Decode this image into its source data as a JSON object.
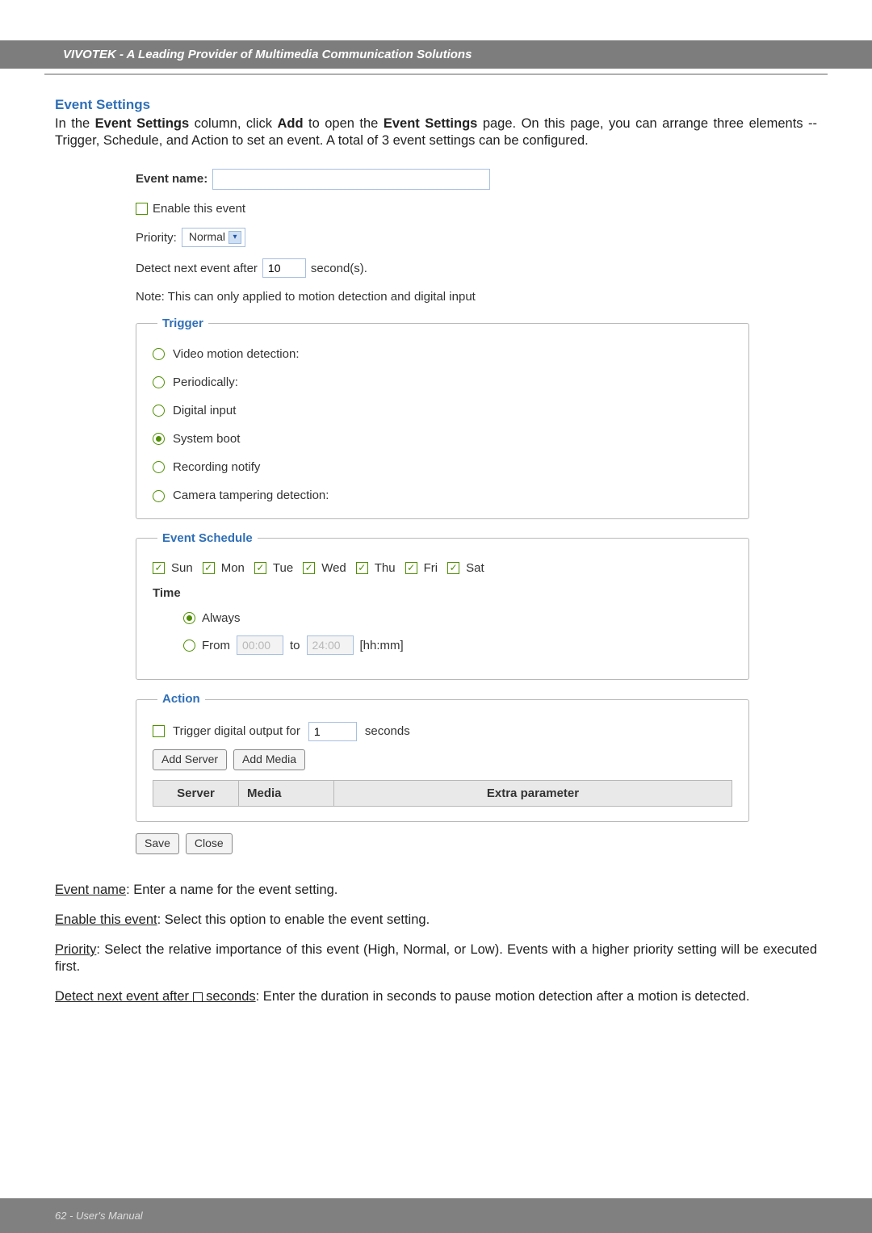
{
  "header": {
    "brand_text": "VIVOTEK - A Leading Provider of Multimedia Communication Solutions"
  },
  "section": {
    "title": "Event Settings",
    "intro_html": "In the <b>Event Settings</b> column, click <b>Add</b> to open the <b>Event Settings</b> page. On this page, you can arrange three elements -- Trigger, Schedule, and Action to set an event. A total of 3 event settings can be configured."
  },
  "form": {
    "event_name_label": "Event name:",
    "event_name_value": "",
    "enable_label": "Enable this event",
    "enable_checked": false,
    "priority_label": "Priority:",
    "priority_value": "Normal",
    "detect_label_prefix": "Detect next event after",
    "detect_value": "10",
    "detect_label_suffix": "second(s).",
    "note_text": "Note: This can only applied to motion detection and digital input"
  },
  "trigger": {
    "legend": "Trigger",
    "options": {
      "video_motion": "Video motion detection:",
      "periodically": "Periodically:",
      "digital_input": "Digital input",
      "system_boot": "System boot",
      "recording_notify": "Recording notify",
      "tampering": "Camera tampering detection:"
    },
    "selected": "system_boot"
  },
  "schedule": {
    "legend": "Event Schedule",
    "days": [
      "Sun",
      "Mon",
      "Tue",
      "Wed",
      "Thu",
      "Fri",
      "Sat"
    ],
    "days_checked": [
      true,
      true,
      true,
      true,
      true,
      true,
      true
    ],
    "time_label": "Time",
    "always_label": "Always",
    "from_label": "From",
    "from_value": "00:00",
    "to_label": "to",
    "to_value": "24:00",
    "hhmm_label": "[hh:mm]",
    "selected": "always"
  },
  "action": {
    "legend": "Action",
    "trigger_do_label": "Trigger digital output for",
    "trigger_do_value": "1",
    "trigger_do_suffix": "seconds",
    "trigger_do_checked": false,
    "add_server_btn": "Add Server",
    "add_media_btn": "Add Media",
    "table_headers": {
      "server": "Server",
      "media": "Media",
      "extra": "Extra parameter"
    }
  },
  "buttons": {
    "save": "Save",
    "close": "Close"
  },
  "descriptions": {
    "event_name": "Event name",
    "event_name_text": ": Enter a name for the event setting.",
    "enable": "Enable this event",
    "enable_text": ": Select this option to enable the event setting.",
    "priority": "Priority",
    "priority_text": ": Select the relative importance of this event (High, Normal, or Low). Events with a higher priority setting will be executed first.",
    "detect_prefix": "Detect next event after ",
    "detect_suffix": " seconds",
    "detect_text": ": Enter the duration in seconds to pause motion detection after a motion is detected."
  },
  "footer": {
    "page_label": "62 - User's Manual"
  }
}
